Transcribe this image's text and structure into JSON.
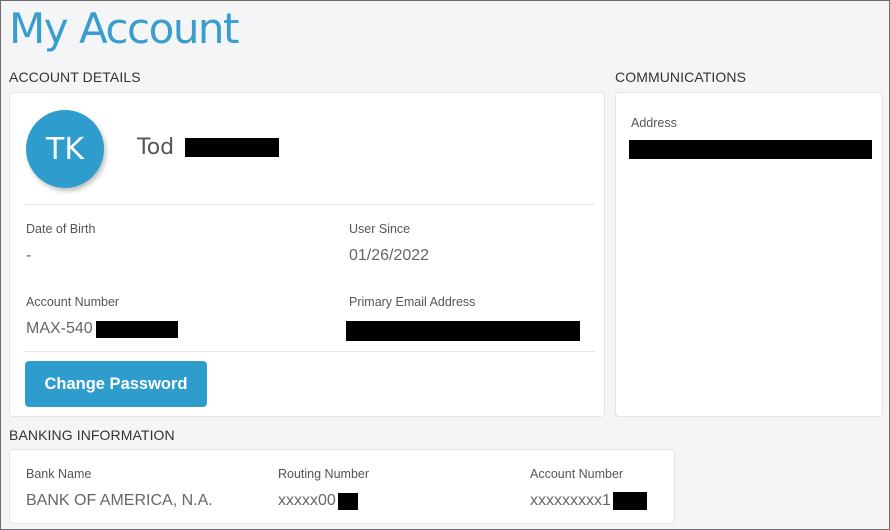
{
  "page_title": "My Account",
  "sections": {
    "account_details": "ACCOUNT DETAILS",
    "communications": "COMMUNICATIONS",
    "banking": "BANKING INFORMATION"
  },
  "account": {
    "initials": "TK",
    "first_name": "Tod",
    "dob_label": "Date of Birth",
    "dob_value": "-",
    "user_since_label": "User Since",
    "user_since_value": "01/26/2022",
    "account_number_label": "Account Number",
    "account_number_prefix": "MAX-540",
    "email_label": "Primary Email Address",
    "change_password_label": "Change Password"
  },
  "communications": {
    "address_label": "Address"
  },
  "banking": {
    "bank_name_label": "Bank Name",
    "bank_name_value": "BANK OF AMERICA, N.A.",
    "routing_label": "Routing Number",
    "routing_prefix": "xxxxx00",
    "account_label": "Account Number",
    "account_prefix": "xxxxxxxxx1"
  },
  "colors": {
    "accent": "#2e9ccd",
    "title": "#3a9ccf",
    "background": "#f3f5f7"
  }
}
